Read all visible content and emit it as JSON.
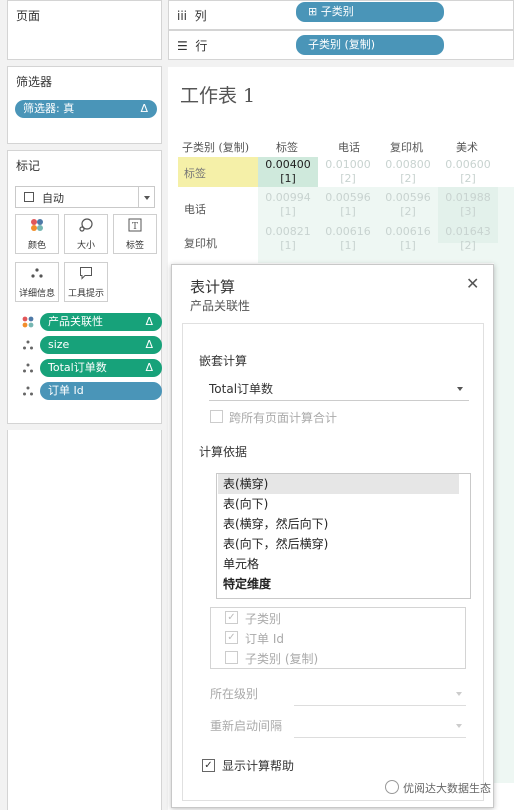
{
  "left": {
    "pages_title": "页面",
    "filters_title": "筛选器",
    "filter_pill": "筛选器: 真",
    "filter_delta": "Δ",
    "marks_title": "标记",
    "mark_type": "自动",
    "mark_buttons": [
      {
        "label": "颜色",
        "icon": "color-dots-icon"
      },
      {
        "label": "大小",
        "icon": "size-icon"
      },
      {
        "label": "标签",
        "icon": "label-T-icon"
      },
      {
        "label": "详细信息",
        "icon": "detail-dots-icon"
      },
      {
        "label": "工具提示",
        "icon": "tooltip-icon"
      }
    ],
    "fields": [
      {
        "label": "产品关联性",
        "delta": "Δ",
        "color": "#17a27a",
        "icon": "color-dots-icon"
      },
      {
        "label": "size",
        "delta": "Δ",
        "color": "#17a27a",
        "icon": "detail-dots-icon"
      },
      {
        "label": "Total订单数",
        "delta": "Δ",
        "color": "#17a27a",
        "icon": "detail-dots-icon"
      },
      {
        "label": "订单 Id",
        "delta": "",
        "color": "#4a95b8",
        "icon": "color-dots-icon"
      }
    ]
  },
  "shelves": {
    "columns_icon": "iii",
    "columns_label": "列",
    "columns_pill": "⊞ 子类别",
    "rows_icon": "☰",
    "rows_label": "行",
    "rows_pill": "子类别 (复制)"
  },
  "sheet": {
    "title": "工作表 1",
    "row_header_title": "子类别 (复制)",
    "col_headers": [
      "标签",
      "电话",
      "复印机",
      "美术"
    ],
    "row_headers": [
      "标签",
      "电话",
      "复印机"
    ],
    "rows": [
      [
        {
          "v": "0.00400",
          "r": "[1]"
        },
        {
          "v": "0.01000",
          "r": "[2]"
        },
        {
          "v": "0.00800",
          "r": "[2]"
        },
        {
          "v": "0.00600",
          "r": "[2]"
        }
      ],
      [
        {
          "v": "0.00994",
          "r": "[1]"
        },
        {
          "v": "0.00596",
          "r": "[1]"
        },
        {
          "v": "0.00596",
          "r": "[2]"
        },
        {
          "v": "0.01988",
          "r": "[3]"
        }
      ],
      [
        {
          "v": "0.00821",
          "r": "[1]"
        },
        {
          "v": "0.00616",
          "r": "[1]"
        },
        {
          "v": "0.00616",
          "r": "[1]"
        },
        {
          "v": "0.01643",
          "r": "[2]"
        }
      ]
    ]
  },
  "dialog": {
    "title": "表计算",
    "subtitle": "产品关联性",
    "close": "✕",
    "nested_label": "嵌套计算",
    "nested_value": "Total订单数",
    "across_pages_label": "跨所有页面计算合计",
    "compute_label": "计算依据",
    "compute_options": [
      "表(横穿)",
      "表(向下)",
      "表(横穿，然后向下)",
      "表(向下，然后横穿)",
      "单元格",
      "特定维度"
    ],
    "selected_option": 0,
    "dimensions": [
      {
        "label": "子类别",
        "checked": true
      },
      {
        "label": "订单 Id",
        "checked": true
      },
      {
        "label": "子类别 (复制)",
        "checked": false
      }
    ],
    "level_label": "所在级别",
    "restart_label": "重新启动间隔",
    "show_help_label": "显示计算帮助",
    "show_help_checked": true
  },
  "watermark": "优阅达大数据生态",
  "colors": {
    "blue_pill": "#4a95b8",
    "green_pill": "#17a27a",
    "highlight_row": "#f5f0a8",
    "highlight_cell": "#cfe9dc"
  }
}
